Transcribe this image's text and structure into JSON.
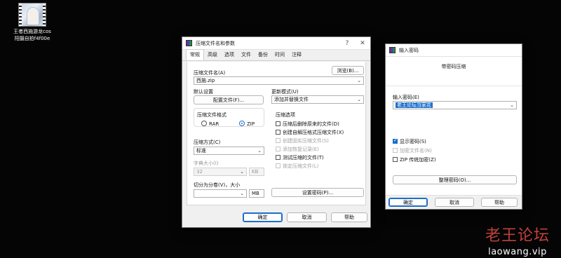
{
  "desktop": {
    "file_label_line1": "王者西施游龙cos",
    "file_label_line2": "阳摄自拍f4f00e"
  },
  "archive_dialog": {
    "title": "压缩文件名和参数",
    "help_btn": "?",
    "close_btn": "✕",
    "tabs": [
      "常规",
      "高级",
      "选项",
      "文件",
      "备份",
      "时间",
      "注释"
    ],
    "active_tab": "常规",
    "archive_name_label": "压缩文件名(A)",
    "browse_button": "浏览(B)...",
    "archive_name_value": "西施.zip",
    "default_settings_label": "默认设置",
    "profiles_button": "配置文件(F)...",
    "update_mode_label": "更新模式(U)",
    "update_mode_value": "添加并替换文件",
    "format_group_label": "压缩文件格式",
    "format_rar": "RAR",
    "format_zip": "ZIP",
    "format_selected": "ZIP",
    "method_label": "压缩方式(C)",
    "method_value": "标准",
    "dict_label": "字典大小(I)",
    "dict_value": "32",
    "dict_unit": "KB",
    "split_label": "切分为分卷(V)，大小",
    "split_value": "",
    "split_unit": "MB",
    "options_group_label": "压缩选项",
    "options": [
      {
        "label": "压缩后删除原来的文件(D)",
        "checked": false,
        "enabled": true
      },
      {
        "label": "创建自解压格式压缩文件(X)",
        "checked": false,
        "enabled": true
      },
      {
        "label": "创建固实压缩文件(S)",
        "checked": false,
        "enabled": false
      },
      {
        "label": "添加恢复记录(E)",
        "checked": false,
        "enabled": false
      },
      {
        "label": "测试压缩的文件(T)",
        "checked": false,
        "enabled": true
      },
      {
        "label": "锁定压缩文件(L)",
        "checked": false,
        "enabled": false
      }
    ],
    "set_password_button": "设置密码(P)...",
    "ok_button": "确定",
    "cancel_button": "取消",
    "help_button": "帮助"
  },
  "password_dialog": {
    "title": "输入密码",
    "header": "带密码压缩",
    "enter_password_label": "输入密码(E)",
    "password_value": "老王论坛当家花",
    "options": [
      {
        "label": "显示密码(S)",
        "checked": true,
        "enabled": true
      },
      {
        "label": "加密文件名(N)",
        "checked": false,
        "enabled": false
      },
      {
        "label": "ZIP 传统加密(Z)",
        "checked": false,
        "enabled": true
      }
    ],
    "organize_button": "整理密码(O)...",
    "ok_button": "确定",
    "cancel_button": "取消",
    "help_button": "帮助"
  },
  "watermark": {
    "chinese": "老王论坛",
    "url": "laowang.vip"
  }
}
